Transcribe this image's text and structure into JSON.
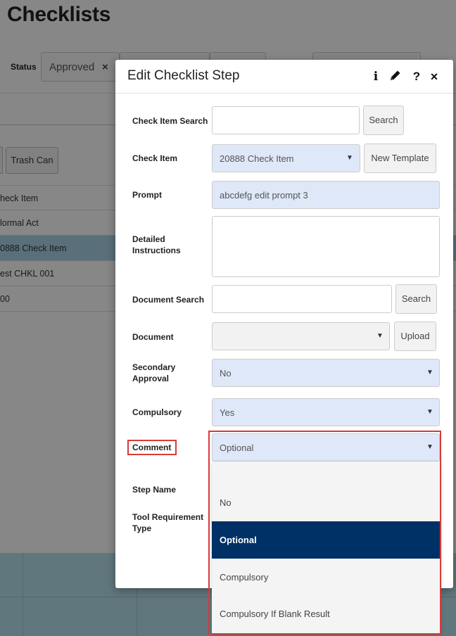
{
  "page": {
    "title": "Checklists",
    "status_label": "Status",
    "status_chip": "Approved",
    "status_chip_remove": "×",
    "trash_button": "Trash Can",
    "list_rows": [
      {
        "text": "heck Item",
        "selected": false
      },
      {
        "text": "lormal Act",
        "selected": false
      },
      {
        "text": "0888 Check Item",
        "selected": true
      },
      {
        "text": "est CHKL 001",
        "selected": false
      },
      {
        "text": "00",
        "selected": false
      }
    ]
  },
  "modal": {
    "title": "Edit Checklist Step",
    "icons": {
      "info": "i",
      "edit": "✎",
      "help": "?",
      "close": "×"
    },
    "check_item_search": {
      "label": "Check Item Search",
      "value": "",
      "button": "Search"
    },
    "check_item": {
      "label": "Check Item",
      "value": "20888 Check Item",
      "button": "New Template"
    },
    "prompt": {
      "label": "Prompt",
      "value": "abcdefg edit prompt 3"
    },
    "detailed_instructions": {
      "label": "Detailed Instructions",
      "value": ""
    },
    "document_search": {
      "label": "Document Search",
      "value": "",
      "button": "Search"
    },
    "document": {
      "label": "Document",
      "value": "",
      "button": "Upload"
    },
    "secondary_approval": {
      "label": "Secondary Approval",
      "value": "No"
    },
    "compulsory": {
      "label": "Compulsory",
      "value": "Yes"
    },
    "comment": {
      "label": "Comment",
      "value": "Optional"
    },
    "step_name": {
      "label": "Step Name"
    },
    "tool_requirement_type": {
      "label": "Tool Requirement Type"
    }
  },
  "comment_dropdown": {
    "options": [
      "",
      "No",
      "Optional",
      "Compulsory",
      "Compulsory If Blank Result"
    ],
    "selected": "Optional"
  },
  "colors": {
    "accent_selected": "#003166",
    "field_blue": "#dfe8f8",
    "highlight_red": "#d93a3a",
    "row_selected": "#a9d2e7"
  }
}
